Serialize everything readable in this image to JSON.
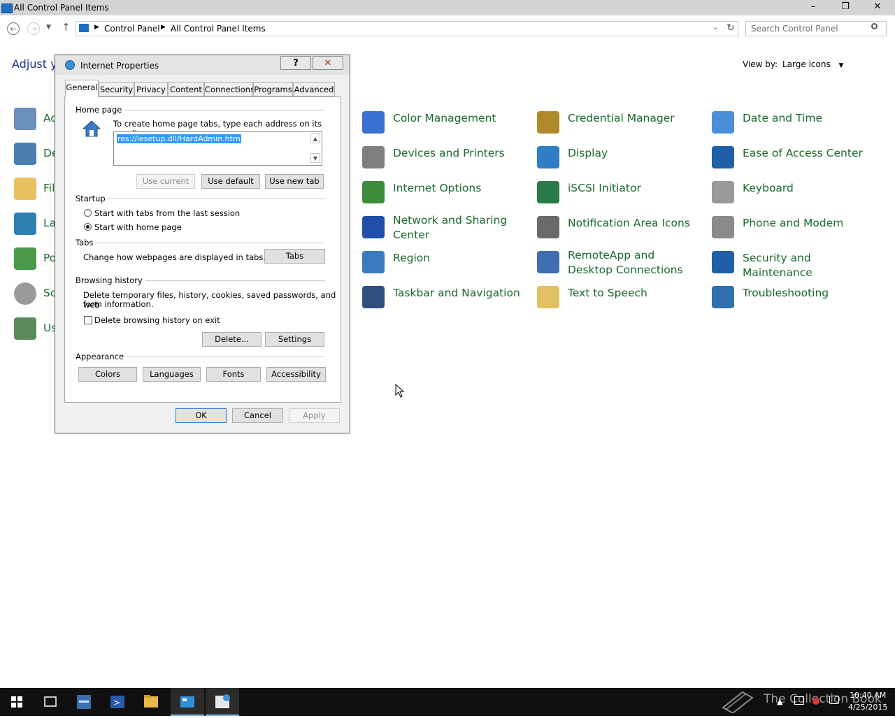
{
  "window": {
    "title": "All Control Panel Items",
    "controls": {
      "minimize": "–",
      "maximize": "❐",
      "close": "✕"
    }
  },
  "navigation": {
    "breadcrumb": [
      "Control Panel",
      "All Control Panel Items"
    ],
    "search_placeholder": "Search Control Panel"
  },
  "control_panel": {
    "adjust_label": "Adjust yo",
    "view_by_label": "View by:",
    "view_by_value": "Large icons",
    "left_column_partial": [
      "Ad",
      "De",
      "Fil",
      "La",
      "Po",
      "So",
      "Us"
    ],
    "items": [
      {
        "label": "Color Management",
        "icon": "color-management-icon",
        "color": "#3b6fd1"
      },
      {
        "label": "Credential Manager",
        "icon": "credential-manager-icon",
        "color": "#b08a2a"
      },
      {
        "label": "Date and Time",
        "icon": "date-time-icon",
        "color": "#4a90d9"
      },
      {
        "label": "Devices and Printers",
        "icon": "devices-printers-icon",
        "color": "#7f7f7f"
      },
      {
        "label": "Display",
        "icon": "display-icon",
        "color": "#2f7dc6"
      },
      {
        "label": "Ease of Access Center",
        "icon": "ease-of-access-icon",
        "color": "#1f5fa8"
      },
      {
        "label": "Internet Options",
        "icon": "internet-options-icon",
        "color": "#3c8c3c"
      },
      {
        "label": "iSCSI Initiator",
        "icon": "iscsi-icon",
        "color": "#2a7a4a"
      },
      {
        "label": "Keyboard",
        "icon": "keyboard-icon",
        "color": "#9a9a9a"
      },
      {
        "label": "Network and Sharing Center",
        "icon": "network-icon",
        "color": "#1f4fa8"
      },
      {
        "label": "Notification Area Icons",
        "icon": "notification-icon",
        "color": "#6a6a6a"
      },
      {
        "label": "Phone and Modem",
        "icon": "phone-modem-icon",
        "color": "#8a8a8a"
      },
      {
        "label": "Region",
        "icon": "region-icon",
        "color": "#3a7ac0"
      },
      {
        "label": "RemoteApp and Desktop Connections",
        "icon": "remoteapp-icon",
        "color": "#3f6fb0"
      },
      {
        "label": "Security and Maintenance",
        "icon": "security-flag-icon",
        "color": "#1f5fa8"
      },
      {
        "label": "Taskbar and Navigation",
        "icon": "taskbar-icon",
        "color": "#2f4f7f"
      },
      {
        "label": "Text to Speech",
        "icon": "text-speech-icon",
        "color": "#e0c060"
      },
      {
        "label": "Troubleshooting",
        "icon": "troubleshooting-icon",
        "color": "#2f6fb0"
      }
    ]
  },
  "dialog": {
    "title": "Internet Properties",
    "help": "?",
    "close": "✕",
    "tabs": [
      "General",
      "Security",
      "Privacy",
      "Content",
      "Connections",
      "Programs",
      "Advanced"
    ],
    "active_tab": "General",
    "home_page": {
      "heading": "Home page",
      "description": "To create home page tabs, type each address on its own line.",
      "url": "res://iesetup.dll/HardAdmin.htm",
      "buttons": {
        "use_current": "Use current",
        "use_default": "Use default",
        "use_new_tab": "Use new tab"
      }
    },
    "startup": {
      "heading": "Startup",
      "option_last_session": "Start with tabs from the last session",
      "option_home_page": "Start with home page",
      "selected": "home_page"
    },
    "tabs_section": {
      "heading": "Tabs",
      "description": "Change how webpages are displayed in tabs.",
      "button": "Tabs"
    },
    "browsing_history": {
      "heading": "Browsing history",
      "description_line1": "Delete temporary files, history, cookies, saved passwords, and web",
      "description_line2": "form information.",
      "checkbox_label": "Delete browsing history on exit",
      "checked": false,
      "delete_button": "Delete...",
      "settings_button": "Settings"
    },
    "appearance": {
      "heading": "Appearance",
      "buttons": [
        "Colors",
        "Languages",
        "Fonts",
        "Accessibility"
      ]
    },
    "footer": {
      "ok": "OK",
      "cancel": "Cancel",
      "apply": "Apply"
    }
  },
  "taskbar": {
    "watermark": "The Collection Book",
    "time": "10:40 AM",
    "date": "4/25/2015"
  },
  "colors": {
    "link_green": "#1a6a2c",
    "title_blue": "#1e3287",
    "taskbar": "#101010",
    "selection": "#3399ff"
  }
}
